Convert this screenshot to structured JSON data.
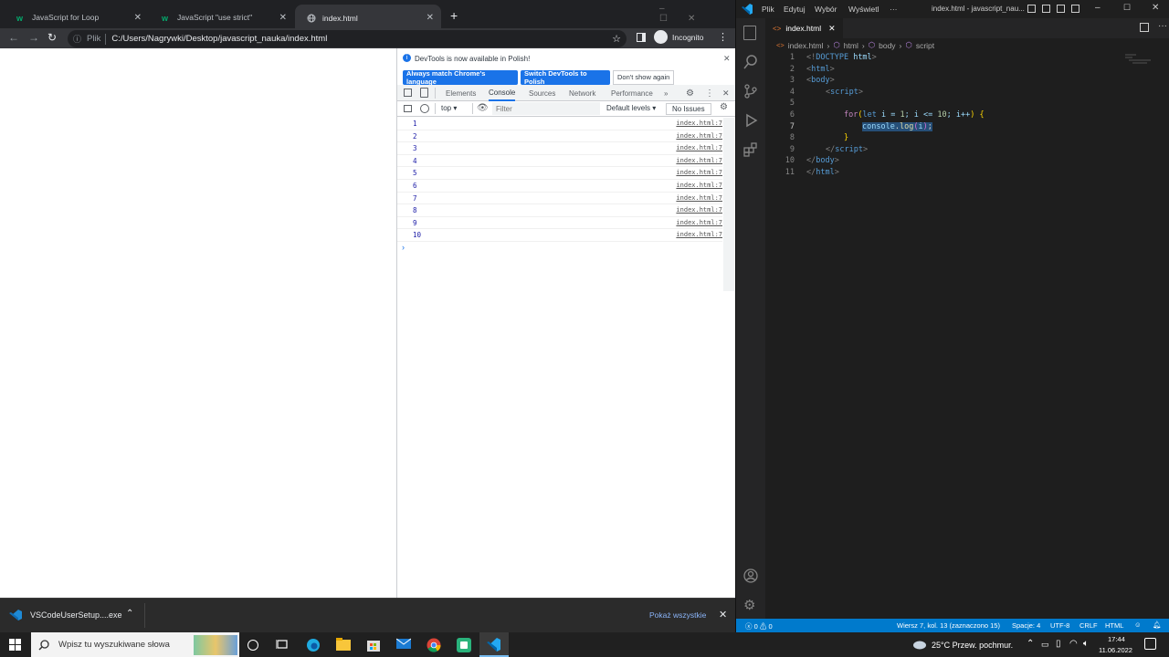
{
  "chrome": {
    "tabs": [
      {
        "title": "JavaScript for Loop",
        "active": false
      },
      {
        "title": "JavaScript \"use strict\"",
        "active": false
      },
      {
        "title": "index.html",
        "active": true
      }
    ],
    "omnibox": {
      "scheme_label": "Plik",
      "url": "C:/Users/Nagrywki/Desktop/javascript_nauka/index.html"
    },
    "profile_label": "Incognito"
  },
  "devtools": {
    "infobar": {
      "message": "DevTools is now available in Polish!",
      "match_label": "Always match Chrome's language",
      "switch_label": "Switch DevTools to Polish",
      "dismiss_label": "Don't show again"
    },
    "tabs": [
      "Elements",
      "Console",
      "Sources",
      "Network",
      "Performance"
    ],
    "active_tab": "Console",
    "console_toolbar": {
      "context": "top",
      "filter_placeholder": "Filter",
      "levels": "Default levels",
      "issues": "No Issues"
    },
    "logs": [
      {
        "value": "1",
        "source": "index.html:7"
      },
      {
        "value": "2",
        "source": "index.html:7"
      },
      {
        "value": "3",
        "source": "index.html:7"
      },
      {
        "value": "4",
        "source": "index.html:7"
      },
      {
        "value": "5",
        "source": "index.html:7"
      },
      {
        "value": "6",
        "source": "index.html:7"
      },
      {
        "value": "7",
        "source": "index.html:7"
      },
      {
        "value": "8",
        "source": "index.html:7"
      },
      {
        "value": "9",
        "source": "index.html:7"
      },
      {
        "value": "10",
        "source": "index.html:7"
      }
    ],
    "prompt": "›"
  },
  "download_bar": {
    "file": "VSCodeUserSetup....exe",
    "show_all": "Pokaż wszystkie"
  },
  "vscode": {
    "menu": [
      "Plik",
      "Edytuj",
      "Wybór",
      "Wyświetl",
      "···"
    ],
    "window_title": "index.html - javascript_nau...",
    "tab": "index.html",
    "breadcrumb": [
      "index.html",
      "html",
      "body",
      "script"
    ],
    "line_numbers": [
      "1",
      "2",
      "3",
      "4",
      "5",
      "6",
      "7",
      "8",
      "9",
      "10",
      "11"
    ],
    "code": {
      "l1_a": "<!",
      "l1_b": "DOCTYPE",
      "l1_c": " html",
      "l1_d": ">",
      "l2": "html",
      "l3": "body",
      "l4": "script",
      "l6_for": "for",
      "l6_let": "let",
      "l6_rest": " i = ",
      "l6_n1": "1",
      "l6_mid": "; i <= ",
      "l6_n2": "10",
      "l6_end": "; i++",
      "l6_brace": "{",
      "l7_obj": "console",
      "l7_dot": ".",
      "l7_fn": "log",
      "l7_arg": "i",
      "l7_semi": ";",
      "l8": "}",
      "l9": "script",
      "l10": "body",
      "l11": "html"
    },
    "status": {
      "problems": "0",
      "warnings": "0",
      "position": "Wiersz 7, kol. 13 (zaznaczono 15)",
      "spaces": "Spacje: 4",
      "encoding": "UTF-8",
      "eol": "CRLF",
      "language": "HTML"
    }
  },
  "taskbar": {
    "search_placeholder": "Wpisz tu wyszukiwane słowa",
    "weather": "25°C  Przew. pochmur.",
    "time": "17:44",
    "date": "11.06.2022"
  },
  "colors": {
    "chrome_dark": "#202124",
    "vscode_blue": "#007acc",
    "devtools_blue": "#1a73e8"
  }
}
